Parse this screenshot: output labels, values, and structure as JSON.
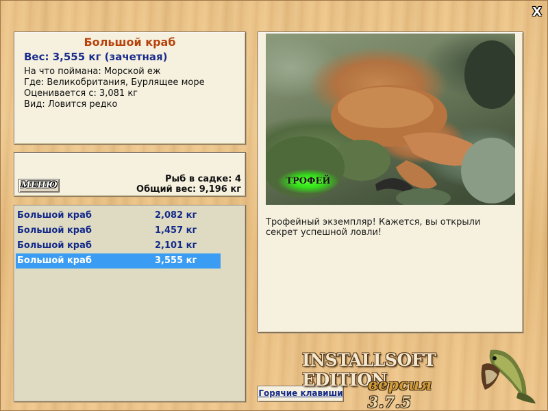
{
  "window": {
    "close_label": "X"
  },
  "catch": {
    "title": "Большой краб",
    "weight_line": "Вес: 3,555 кг (зачетная)",
    "details": [
      "На что поймана: Морской еж",
      "Где: Великобритания, Бурлящее море",
      "Оценивается с: 3,081 кг",
      "Вид: Ловится редко"
    ]
  },
  "menu": {
    "button_label": "МЕНЮ",
    "keepnet_count": "Рыб в садке: 4",
    "total_weight": "Общий вес: 9,196 кг"
  },
  "keepnet": {
    "rows": [
      {
        "name": "Большой краб",
        "weight": "2,082 кг",
        "selected": false
      },
      {
        "name": "Большой краб",
        "weight": "1,457 кг",
        "selected": false
      },
      {
        "name": "Большой краб",
        "weight": "2,101 кг",
        "selected": false
      },
      {
        "name": "Большой краб",
        "weight": "3,555 кг",
        "selected": true
      }
    ],
    "selected_color": "#3a9cf2"
  },
  "photo": {
    "badge": "ТРОФЕЙ",
    "description": "Трофейный экземпляр! Кажется, вы открыли секрет успешной ловли!"
  },
  "footer": {
    "hotkeys_label": "Горячие клавиши",
    "brand": "INSTALLSOFT EDITION",
    "version_word": "версия",
    "version_number": "3.7.5",
    "logo_icon": "pike-fish-icon"
  }
}
